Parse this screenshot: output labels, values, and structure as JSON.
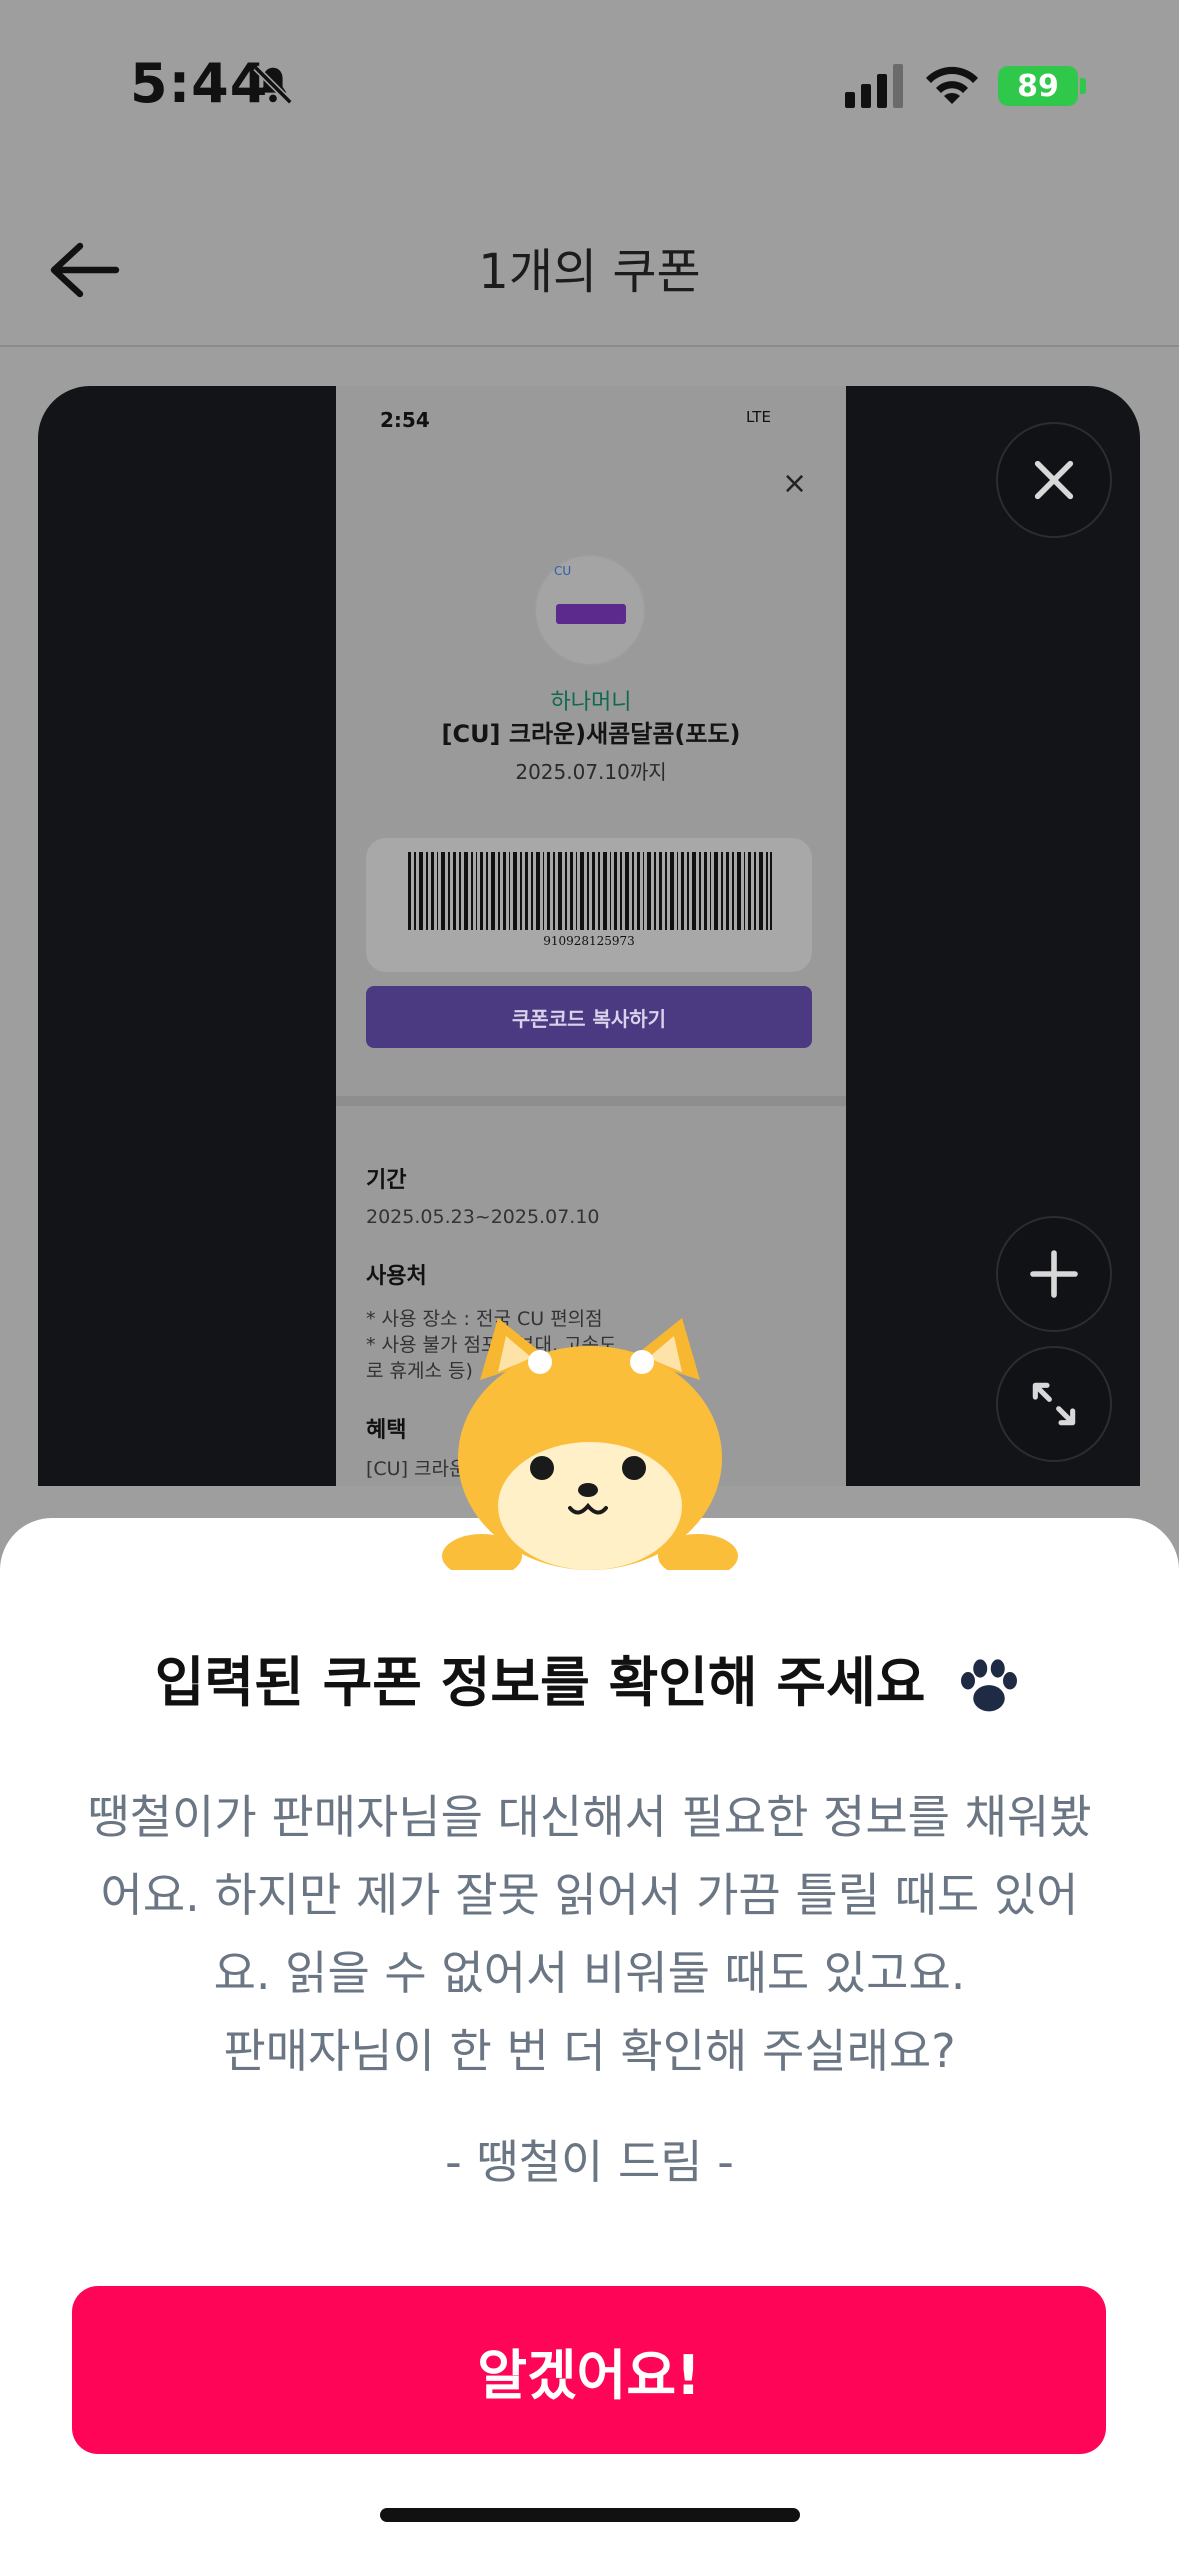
{
  "status": {
    "time": "5:44",
    "battery": "89"
  },
  "header": {
    "title": "1개의 쿠폰"
  },
  "coupon_screenshot": {
    "time": "2:54",
    "network": "LTE",
    "brand": "하나머니",
    "product": "[CU] 크라운)새콤달콤(포도)",
    "expire": "2025.07.10까지",
    "barcode_number": "910928125973",
    "copy_button": "쿠폰코드 복사하기",
    "period_label": "기간",
    "period_value": "2025.05.23~2025.07.10",
    "usage_label": "사용처",
    "usage_line1": "* 사용 장소 : 전국 CU 편의점",
    "usage_line2": "* 사용 불가 점포 :                   부대, 고속도",
    "usage_line3": "로 휴게소 등)",
    "benefit_label": "혜택",
    "benefit_value": "[CU] 크라운"
  },
  "sheet": {
    "title": "입력된 쿠폰 정보를 확인해 주세요",
    "body_lines": [
      "땡철이가 판매자님을 대신해서 필요한 정보를 채워봤",
      "어요. 하지만 제가 잘못 읽어서 가끔 틀릴 때도 있어",
      "요. 읽을 수 없어서 비워둘 때도 있고요.",
      "판매자님이 한 번 더 확인해 주실래요?"
    ],
    "signature": "- 땡철이 드림 -",
    "confirm_button": "알겠어요!"
  },
  "colors": {
    "accent": "#ff0558",
    "dim_overlay": "#9e9e9e",
    "body_text": "#6b7684"
  },
  "icons": [
    "back-arrow-icon",
    "close-icon",
    "zoom-in-icon",
    "expand-icon",
    "paw-icon",
    "bell-slash-icon",
    "signal-icon",
    "wifi-icon"
  ]
}
